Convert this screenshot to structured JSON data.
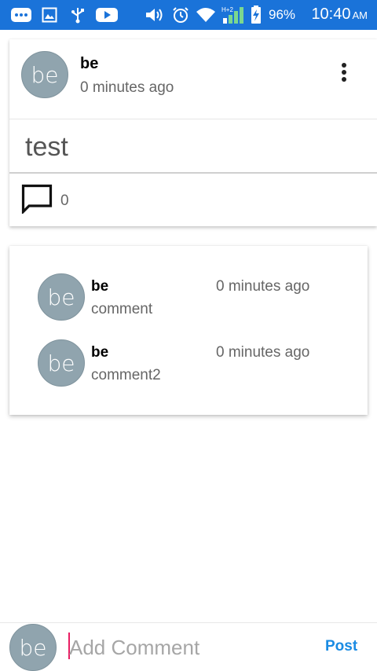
{
  "status_bar": {
    "battery_percent": "96%",
    "time": "10:40",
    "ampm": "AM",
    "background_color": "#1a73d9",
    "icons": [
      "message-icon",
      "image-icon",
      "usb-icon",
      "youtube-icon",
      "volume-icon",
      "alarm-icon",
      "wifi-icon",
      "signal-icon",
      "battery-charging-icon"
    ]
  },
  "post": {
    "avatar_initials": "be",
    "author": "be",
    "time_ago": "0 minutes ago",
    "body": "test",
    "comment_count": "0"
  },
  "comments": [
    {
      "avatar_initials": "be",
      "author": "be",
      "time_ago": "0 minutes ago",
      "text": "comment"
    },
    {
      "avatar_initials": "be",
      "author": "be",
      "time_ago": "0 minutes ago",
      "text": "comment2"
    }
  ],
  "composer": {
    "avatar_initials": "be",
    "placeholder": "Add Comment",
    "post_label": "Post",
    "accent_color": "#1a8be3",
    "caret_color": "#e91e63"
  },
  "colors": {
    "avatar_bg": "#90a4ae"
  }
}
